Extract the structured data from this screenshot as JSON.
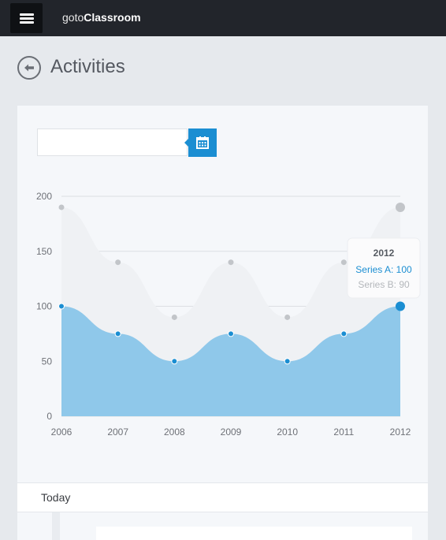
{
  "header": {
    "brand_prefix": "goto",
    "brand_name": "Classroom",
    "menu_icon": "hamburger-icon"
  },
  "page": {
    "title": "Activities",
    "back_icon": "arrow-left-circle-icon"
  },
  "date_picker": {
    "value": "",
    "icon": "calendar-icon"
  },
  "chart_data": {
    "type": "area",
    "categories": [
      "2006",
      "2007",
      "2008",
      "2009",
      "2010",
      "2011",
      "2012"
    ],
    "series": [
      {
        "name": "Series A",
        "values": [
          100,
          75,
          50,
          75,
          50,
          75,
          100
        ],
        "color": "#1b8ed2"
      },
      {
        "name": "Series B",
        "values": [
          190,
          140,
          90,
          140,
          90,
          140,
          190
        ],
        "color": "#c2c5c9"
      }
    ],
    "ylim": [
      0,
      200
    ],
    "yticks": [
      0,
      50,
      100,
      150,
      200
    ],
    "grid": true,
    "tooltip": {
      "title": "2012",
      "lines": [
        {
          "series": "Series A",
          "text": "Series A: 100"
        },
        {
          "series": "Series B",
          "text": "Series B: 90"
        }
      ]
    },
    "colors": {
      "area_a": "#8fc8ea",
      "area_b": "#eff1f4",
      "grid": "#dcdfe3"
    }
  },
  "section": {
    "label": "Today"
  }
}
